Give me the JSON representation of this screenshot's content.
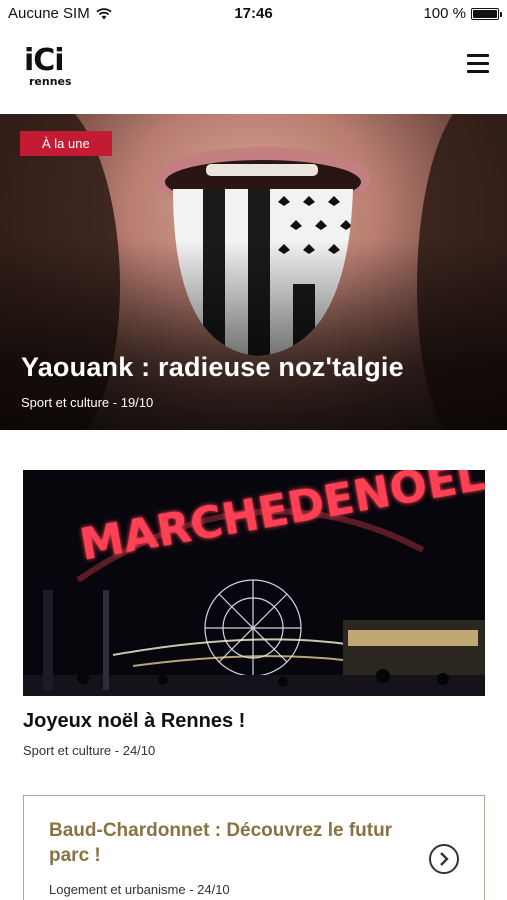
{
  "status_bar": {
    "carrier": "Aucune SIM",
    "time": "17:46",
    "battery": "100 %",
    "battery_level": 1.0
  },
  "header": {
    "logo_mark": "iCi",
    "logo_sub": "rennes",
    "menu_icon": "hamburger-icon"
  },
  "hero": {
    "badge": "À la une",
    "title": "Yaouank : radieuse noz'talgie",
    "meta": "Sport et culture - 19/10"
  },
  "article": {
    "image_sign": "MARCHEDENOEL",
    "title": "Joyeux noël à Rennes !",
    "meta": "Sport et culture - 24/10"
  },
  "box_card": {
    "title": "Baud-Chardonnet : Découvrez le futur parc !",
    "meta": "Logement et urbanisme - 24/10",
    "arrow_icon": "chevron-right-circle-icon"
  },
  "colors": {
    "badge_bg": "#c21b33",
    "box_title": "#8a7246",
    "box_border": "#b0a89a"
  }
}
